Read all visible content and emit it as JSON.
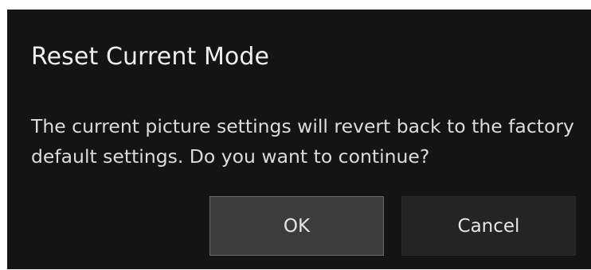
{
  "dialog": {
    "title": "Reset Current Mode",
    "message": "The current picture settings will revert back to the factory default settings. Do you want to continue?",
    "buttons": {
      "ok_label": "OK",
      "cancel_label": "Cancel"
    },
    "focused_button": "OK"
  },
  "colors": {
    "dialog_background": "#141414",
    "focused_button": "#3c3c3c",
    "button": "#242424",
    "text": "#e6e6e6"
  }
}
